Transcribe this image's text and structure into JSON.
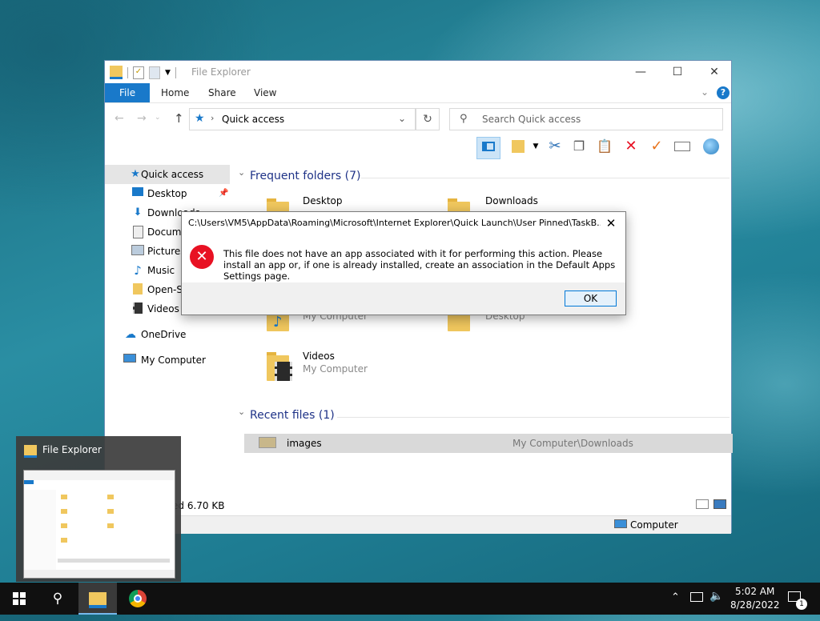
{
  "window": {
    "title": "File Explorer",
    "controls": {
      "minimize": "—",
      "maximize": "☐",
      "close": "✕"
    }
  },
  "ribbon": {
    "tabs": [
      "File",
      "Home",
      "Share",
      "View"
    ]
  },
  "address": {
    "path": "Quick access",
    "search_placeholder": "Search Quick access"
  },
  "nav": {
    "items": [
      {
        "label": "Quick access",
        "icon": "star-icon"
      },
      {
        "label": "Desktop",
        "icon": "desktop-icon"
      },
      {
        "label": "Downloads",
        "icon": "download-icon"
      },
      {
        "label": "Documents",
        "icon": "document-icon"
      },
      {
        "label": "Pictures",
        "icon": "picture-icon"
      },
      {
        "label": "Music",
        "icon": "music-icon"
      },
      {
        "label": "Open-Shell",
        "icon": "folder-icon"
      },
      {
        "label": "Videos",
        "icon": "video-icon"
      },
      {
        "label": "OneDrive",
        "icon": "cloud-icon"
      },
      {
        "label": "My Computer",
        "icon": "computer-icon"
      }
    ]
  },
  "content": {
    "frequent_header": "Frequent folders (7)",
    "recent_header": "Recent files (1)",
    "folders": [
      {
        "title": "Desktop",
        "sub": ""
      },
      {
        "title": "Downloads",
        "sub": ""
      },
      {
        "title": "",
        "sub": "My Computer"
      },
      {
        "title": "",
        "sub": "Desktop"
      },
      {
        "title": "Videos",
        "sub": "My Computer"
      }
    ],
    "recent_files": [
      {
        "name": "images",
        "location": "My Computer\\Downloads"
      }
    ]
  },
  "status": {
    "text": "1 item selected  6.70 KB",
    "bottom_location": "Computer"
  },
  "dialog": {
    "title": "C:\\Users\\VM5\\AppData\\Roaming\\Microsoft\\Internet Explorer\\Quick Launch\\User Pinned\\TaskB...",
    "message": "This file does not have an app associated with it for performing this action. Please install an app or, if one is already installed, create an association in the Default Apps Settings page.",
    "ok_label": "OK",
    "error_icon": "error-icon"
  },
  "preview": {
    "title": "File Explorer"
  },
  "taskbar": {
    "time": "5:02 AM",
    "date": "8/28/2022",
    "notification_count": "1"
  },
  "colors": {
    "accent": "#1979ca",
    "error": "#e81123",
    "section_header": "#1e3287"
  }
}
